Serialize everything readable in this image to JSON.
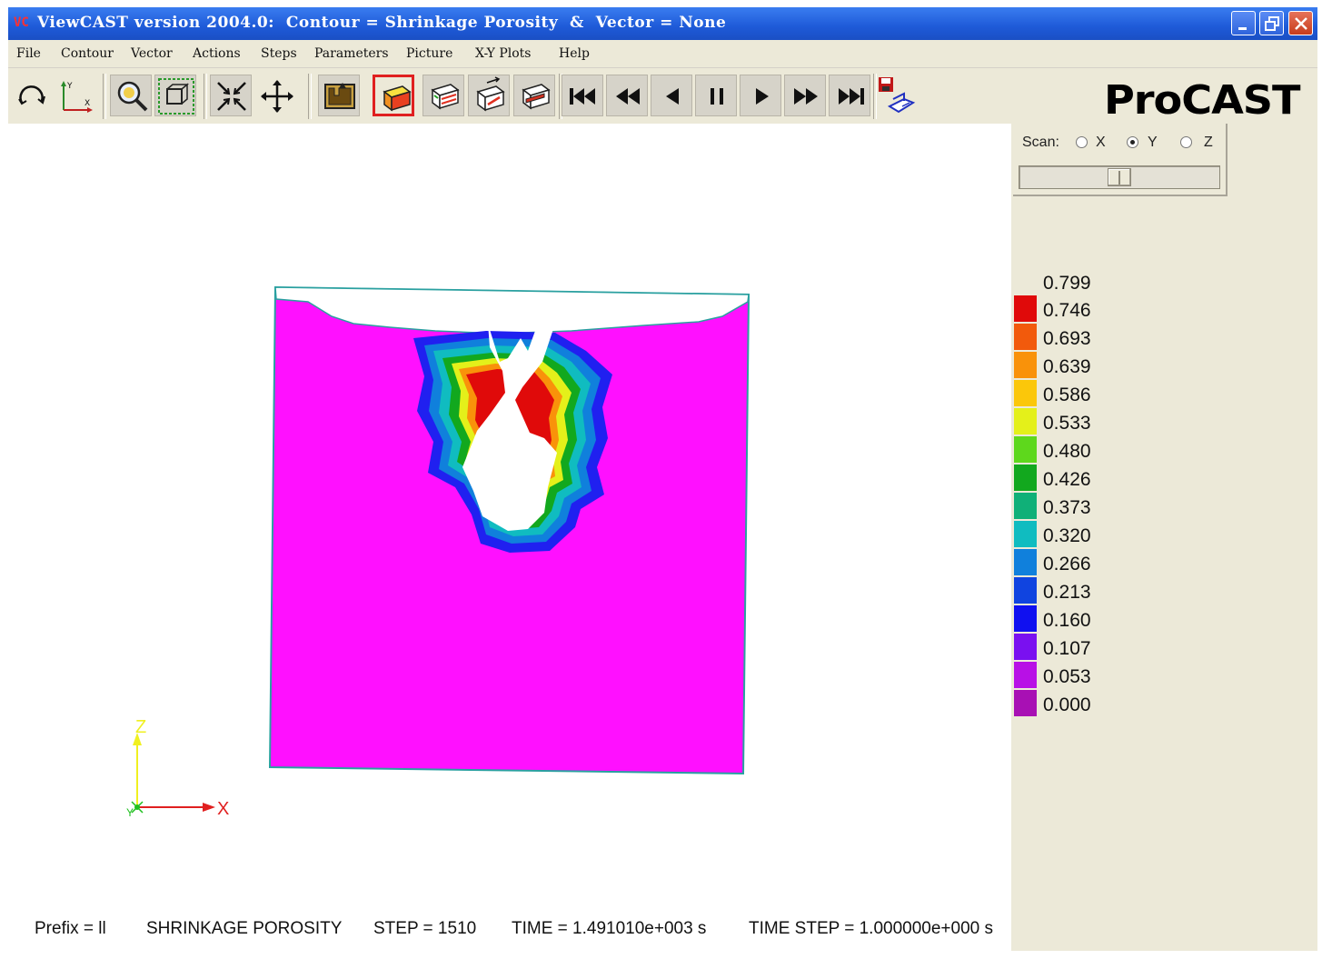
{
  "window": {
    "title": "ViewCAST version 2004.0:  Contour = Shrinkage Porosity  &  Vector = None",
    "app_icon_text": "VC"
  },
  "menu": {
    "items": [
      "File",
      "Contour",
      "Vector",
      "Actions",
      "Steps",
      "Parameters",
      "Picture",
      "X-Y Plots",
      "Help"
    ]
  },
  "toolbar": {
    "buttons": [
      {
        "name": "rotate-icon"
      },
      {
        "name": "axes-icon"
      },
      {
        "name": "zoom-icon"
      },
      {
        "name": "zoom-box-icon"
      },
      {
        "name": "fit-icon"
      },
      {
        "name": "pan-icon"
      },
      {
        "name": "mold-icon"
      },
      {
        "name": "contour-fill-icon",
        "active": true
      },
      {
        "name": "contour-lines-icon"
      },
      {
        "name": "vector-icon"
      },
      {
        "name": "cut-plane-icon"
      },
      {
        "name": "first-step-icon"
      },
      {
        "name": "fast-backward-icon"
      },
      {
        "name": "step-backward-icon"
      },
      {
        "name": "pause-icon"
      },
      {
        "name": "step-forward-icon"
      },
      {
        "name": "fast-forward-icon"
      },
      {
        "name": "last-step-icon"
      },
      {
        "name": "save-picture-icon"
      }
    ],
    "brand": "ProCAST"
  },
  "scan": {
    "label": "Scan:",
    "options": [
      "X",
      "Y",
      "Z"
    ],
    "selected": "Y",
    "slider_position": 0.5
  },
  "legend": {
    "top_label": "0.799",
    "entries": [
      {
        "value": "0.746",
        "color": "#e00a0a"
      },
      {
        "value": "0.693",
        "color": "#f25a0c"
      },
      {
        "value": "0.639",
        "color": "#f9920a"
      },
      {
        "value": "0.586",
        "color": "#fbc70a"
      },
      {
        "value": "0.533",
        "color": "#e4f01a"
      },
      {
        "value": "0.480",
        "color": "#5ed81c"
      },
      {
        "value": "0.426",
        "color": "#12a81e"
      },
      {
        "value": "0.373",
        "color": "#10b078"
      },
      {
        "value": "0.320",
        "color": "#10bcc0"
      },
      {
        "value": "0.266",
        "color": "#1080dc"
      },
      {
        "value": "0.213",
        "color": "#1044e0"
      },
      {
        "value": "0.160",
        "color": "#1010f0"
      },
      {
        "value": "0.107",
        "color": "#7a10f0"
      },
      {
        "value": "0.053",
        "color": "#b810e6"
      },
      {
        "value": "0.000",
        "color": "#a810b4"
      }
    ]
  },
  "model": {
    "fill_color": "#ff10ff",
    "outline_color": "#2aa0a0"
  },
  "axes": {
    "vertical": "Z",
    "horizontal": "X",
    "depth": "Y"
  },
  "status": {
    "prefix": "Prefix = ll",
    "quantity": "SHRINKAGE POROSITY",
    "step": "STEP = 1510",
    "time": "TIME = 1.491010e+003 s",
    "time_step": "TIME STEP = 1.000000e+000 s"
  }
}
